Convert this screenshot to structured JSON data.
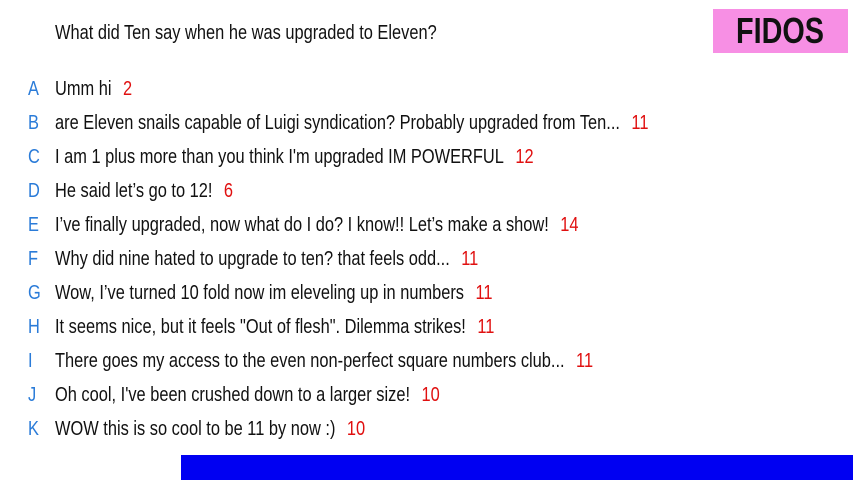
{
  "question": "What did Ten say when he was upgraded to Eleven?",
  "logo": "FIDOS",
  "answers": [
    {
      "letter": "A",
      "text": "Umm hi",
      "votes": "2"
    },
    {
      "letter": "B",
      "text": "are Eleven snails capable of Luigi syndication? Probably upgraded from Ten...",
      "votes": "11"
    },
    {
      "letter": "C",
      "text": "I am 1 plus more than you think I'm upgraded  IM POWERFUL",
      "votes": "12"
    },
    {
      "letter": "D",
      "text": "He said let’s go to 12!",
      "votes": "6"
    },
    {
      "letter": "E",
      "text": "I’ve finally upgraded, now what do I do? I know!! Let’s make a show!",
      "votes": "14"
    },
    {
      "letter": "F",
      "text": "Why did nine hated to upgrade to ten? that feels odd...",
      "votes": "11"
    },
    {
      "letter": "G",
      "text": "Wow, I’ve turned 10 fold now im eleveling up in numbers",
      "votes": "11"
    },
    {
      "letter": "H",
      "text": "It seems nice, but it feels \"Out of flesh\". Dilemma strikes!",
      "votes": "11"
    },
    {
      "letter": "I",
      "text": "There goes my access to the even non-perfect square numbers club...",
      "votes": "11"
    },
    {
      "letter": "J",
      "text": "Oh cool, I've been crushed down to a larger size!",
      "votes": "10"
    },
    {
      "letter": "K",
      "text": "WOW this is so cool to be 11 by now :)",
      "votes": "10"
    }
  ]
}
